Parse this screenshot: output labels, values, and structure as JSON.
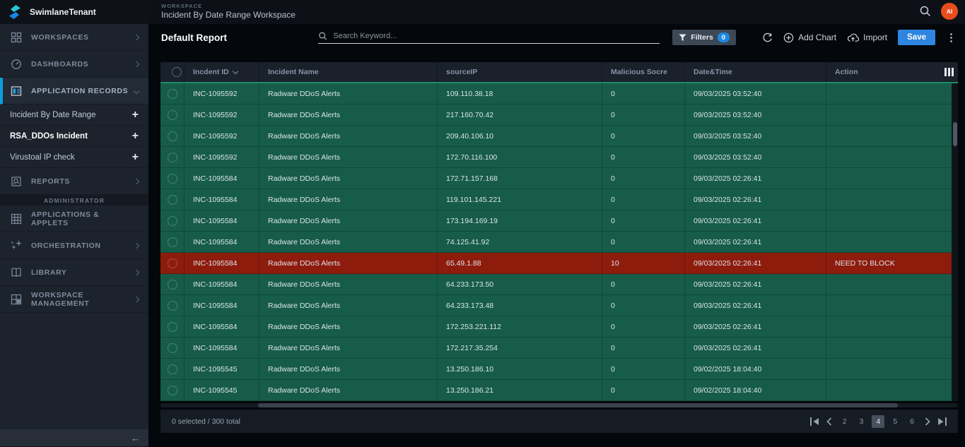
{
  "sidebar": {
    "tenant_name": "SwimlaneTenant",
    "nav_workspaces": "WORKSPACES",
    "nav_dashboards": "DASHBOARDS",
    "nav_application_records": "APPLICATION RECORDS",
    "records_items": [
      {
        "label": "Incident By Date Range"
      },
      {
        "label": "RSA_DDOs Incident"
      },
      {
        "label": "Virustoal IP check"
      }
    ],
    "nav_reports": "REPORTS",
    "admin_section_label": "ADMINISTRATOR",
    "nav_applications_applets": "APPLICATIONS & APPLETS",
    "nav_orchestration": "ORCHESTRATION",
    "nav_library": "LIBRARY",
    "nav_workspace_management": "WORKSPACE MANAGEMENT"
  },
  "header": {
    "eyebrow": "WORKSPACE",
    "title": "Incident By Date Range Workspace",
    "avatar_initials": "AI"
  },
  "toolbar": {
    "report_title": "Default Report",
    "search_placeholder": "Search Keyword...",
    "filters_label": "Filters",
    "filters_count": "0",
    "add_chart_label": "Add Chart",
    "import_label": "Import",
    "save_label": "Save"
  },
  "table": {
    "columns": [
      "Incdent ID",
      "Incident Name",
      "sourceIP",
      "Malicious Socre",
      "Date&Time",
      "Action"
    ],
    "rows": [
      {
        "id": "INC-1095592",
        "name": "Radware DDoS Alerts",
        "ip": "109.110.38.18",
        "score": "0",
        "datetime": "09/03/2025 03:52:40",
        "action": "",
        "alert": false
      },
      {
        "id": "INC-1095592",
        "name": "Radware DDoS Alerts",
        "ip": "217.160.70.42",
        "score": "0",
        "datetime": "09/03/2025 03:52:40",
        "action": "",
        "alert": false
      },
      {
        "id": "INC-1095592",
        "name": "Radware DDoS Alerts",
        "ip": "209.40.106.10",
        "score": "0",
        "datetime": "09/03/2025 03:52:40",
        "action": "",
        "alert": false
      },
      {
        "id": "INC-1095592",
        "name": "Radware DDoS Alerts",
        "ip": "172.70.116.100",
        "score": "0",
        "datetime": "09/03/2025 03:52:40",
        "action": "",
        "alert": false
      },
      {
        "id": "INC-1095584",
        "name": "Radware DDoS Alerts",
        "ip": "172.71.157.168",
        "score": "0",
        "datetime": "09/03/2025 02:26:41",
        "action": "",
        "alert": false
      },
      {
        "id": "INC-1095584",
        "name": "Radware DDoS Alerts",
        "ip": "119.101.145.221",
        "score": "0",
        "datetime": "09/03/2025 02:26:41",
        "action": "",
        "alert": false
      },
      {
        "id": "INC-1095584",
        "name": "Radware DDoS Alerts",
        "ip": "173.194.169.19",
        "score": "0",
        "datetime": "09/03/2025 02:26:41",
        "action": "",
        "alert": false
      },
      {
        "id": "INC-1095584",
        "name": "Radware DDoS Alerts",
        "ip": "74.125.41.92",
        "score": "0",
        "datetime": "09/03/2025 02:26:41",
        "action": "",
        "alert": false
      },
      {
        "id": "INC-1095584",
        "name": "Radware DDoS Alerts",
        "ip": "65.49.1.88",
        "score": "10",
        "datetime": "09/03/2025 02:26:41",
        "action": "NEED TO BLOCK",
        "alert": true
      },
      {
        "id": "INC-1095584",
        "name": "Radware DDoS Alerts",
        "ip": "64.233.173.50",
        "score": "0",
        "datetime": "09/03/2025 02:26:41",
        "action": "",
        "alert": false
      },
      {
        "id": "INC-1095584",
        "name": "Radware DDoS Alerts",
        "ip": "64.233.173.48",
        "score": "0",
        "datetime": "09/03/2025 02:26:41",
        "action": "",
        "alert": false
      },
      {
        "id": "INC-1095584",
        "name": "Radware DDoS Alerts",
        "ip": "172.253.221.112",
        "score": "0",
        "datetime": "09/03/2025 02:26:41",
        "action": "",
        "alert": false
      },
      {
        "id": "INC-1095584",
        "name": "Radware DDoS Alerts",
        "ip": "172.217.35.254",
        "score": "0",
        "datetime": "09/03/2025 02:26:41",
        "action": "",
        "alert": false
      },
      {
        "id": "INC-1095545",
        "name": "Radware DDoS Alerts",
        "ip": "13.250.186.10",
        "score": "0",
        "datetime": "09/02/2025 18:04:40",
        "action": "",
        "alert": false
      },
      {
        "id": "INC-1095545",
        "name": "Radware DDoS Alerts",
        "ip": "13.250.186.21",
        "score": "0",
        "datetime": "09/02/2025 18:04:40",
        "action": "",
        "alert": false
      }
    ]
  },
  "footer": {
    "selection_summary": "0 selected / 300 total",
    "pages": [
      "2",
      "3",
      "4",
      "5",
      "6"
    ],
    "active_page": "4"
  },
  "icons": {
    "plus": "+",
    "kebab": "⋮",
    "collapse_arrow": "←"
  },
  "colors": {
    "accent_blue": "#0c9fe0",
    "row_green": "#165c49",
    "alert_red": "#8e1c0d",
    "header_underline": "#1f8a66",
    "save_blue": "#2e86e0",
    "avatar_orange": "#e84e1b",
    "badge_blue": "#1f88e5"
  }
}
